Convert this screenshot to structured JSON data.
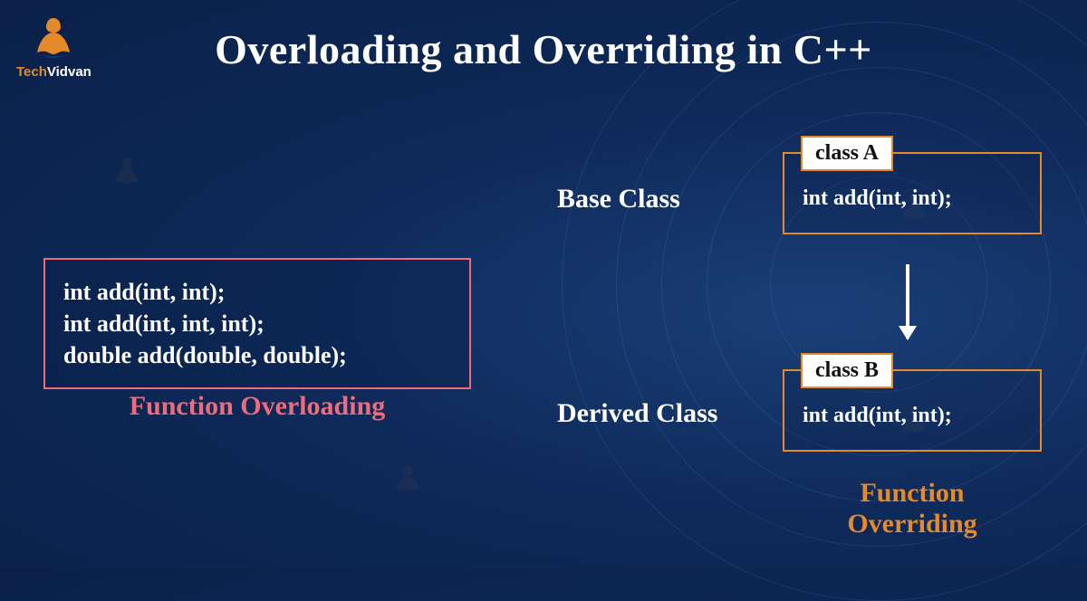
{
  "brand": {
    "name_part1": "Tech",
    "name_part2": "Vidvan"
  },
  "title": "Overloading and Overriding in C++",
  "overloading": {
    "code_lines": [
      "int add(int, int);",
      "int add(int, int, int);",
      "double add(double, double);"
    ],
    "caption": "Function Overloading"
  },
  "overriding": {
    "base_label": "Base Class",
    "derived_label": "Derived Class",
    "class_a": {
      "tag": "class A",
      "signature": "int add(int, int);"
    },
    "class_b": {
      "tag": "class B",
      "signature": "int add(int, int);"
    },
    "caption_line1": "Function",
    "caption_line2": "Overriding"
  },
  "colors": {
    "accent_orange": "#e58a2b",
    "accent_pink": "#ef6d7a",
    "bg": "#0e2a5a"
  }
}
